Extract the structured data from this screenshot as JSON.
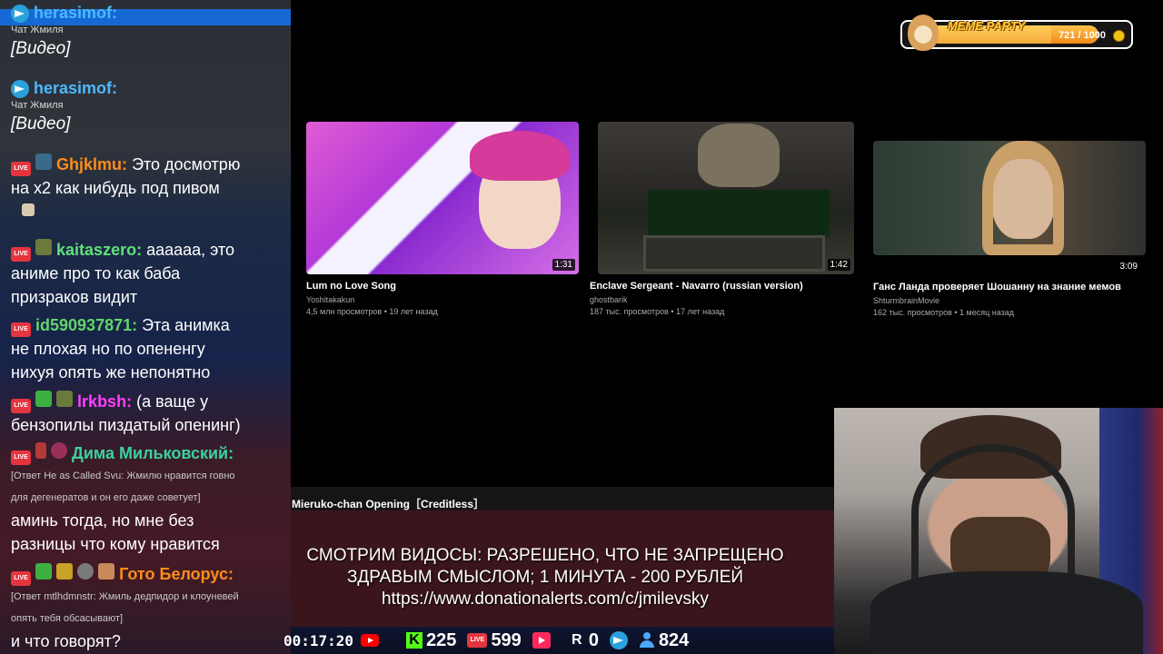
{
  "chat": {
    "messages": [
      {
        "user": "herasimof:",
        "user_color": "#4db8ff",
        "sub": "Чат Жмиля",
        "text": "[Видео]"
      },
      {
        "user": "herasimof:",
        "user_color": "#4db8ff",
        "sub": "Чат Жмиля",
        "text": "[Видео]"
      },
      {
        "user": "Ghjklmu:",
        "user_color": "#ff8c1a",
        "lines": [
          "Это досмотрю",
          "на х2 как нибудь под пивом"
        ]
      },
      {
        "user": "kaitaszero:",
        "user_color": "#5fe07a",
        "lines": [
          "аааааа, это",
          "аниме про то как баба",
          "призраков видит"
        ]
      },
      {
        "user": "id590937871:",
        "user_color": "#62d56a",
        "lines": [
          "Эта анимка",
          "не плохая но по опененгу",
          "нихуя опять же непонятно"
        ]
      },
      {
        "user": "lrkbsh:",
        "user_color": "#ff40ff",
        "lines": [
          "(а ваще у",
          "бензопилы пиздатый опенинг)"
        ]
      },
      {
        "user": "Дима Мильковский:",
        "user_color": "#3cd1a0",
        "reply_lines": [
          "[Ответ He as Called Svu: Жмилю нравится говно",
          "для дегенератов и он его даже советует]"
        ],
        "lines": [
          "аминь тогда, но мне без",
          "разницы что кому нравится"
        ]
      },
      {
        "user": "Гото Белорус:",
        "user_color": "#ff8c1a",
        "reply_lines": [
          "[Ответ mtlhdmnstr: Жмиль дедпидор и клоуневей",
          "опять тебя обсасывают]"
        ],
        "lines": [
          "и что говорят?"
        ]
      }
    ]
  },
  "videos": [
    {
      "title": "Lum no Love Song",
      "channel": "Yoshitakakun",
      "meta": "4,5 млн просмотров • 19 лет назад",
      "duration": "1:31"
    },
    {
      "title": "Enclave Sergeant - Navarro (russian version)",
      "channel": "ghostbarik",
      "meta": "187 тыс. просмотров • 17 лет назад",
      "duration": "1:42"
    },
    {
      "title": "Ганс Ланда проверяет Шошанну на знание мемов",
      "channel": "ShturmbrainMovie",
      "meta": "162 тыс. просмотров • 1 месяц назад",
      "duration": "3:09"
    }
  ],
  "now_playing": "Mieruko-chan Opening［Creditless］",
  "rules": {
    "line1": "СМОТРИМ ВИДОСЫ: РАЗРЕШЕНО, ЧТО НЕ ЗАПРЕЩЕНО",
    "line2": "ЗДРАВЫМ СМЫСЛОМ; 1 МИНУТА - 200 РУБЛЕЙ",
    "line3": "https://www.donationalerts.com/c/jmilevsky"
  },
  "meme_party": {
    "title": "MEME PARTY",
    "progress": "721 / 1000",
    "progress_fraction": 0.721
  },
  "stats": {
    "uptime": "00:17:20",
    "kick": "225",
    "vk_live": "599",
    "rutube": "0",
    "viewers": "824"
  }
}
